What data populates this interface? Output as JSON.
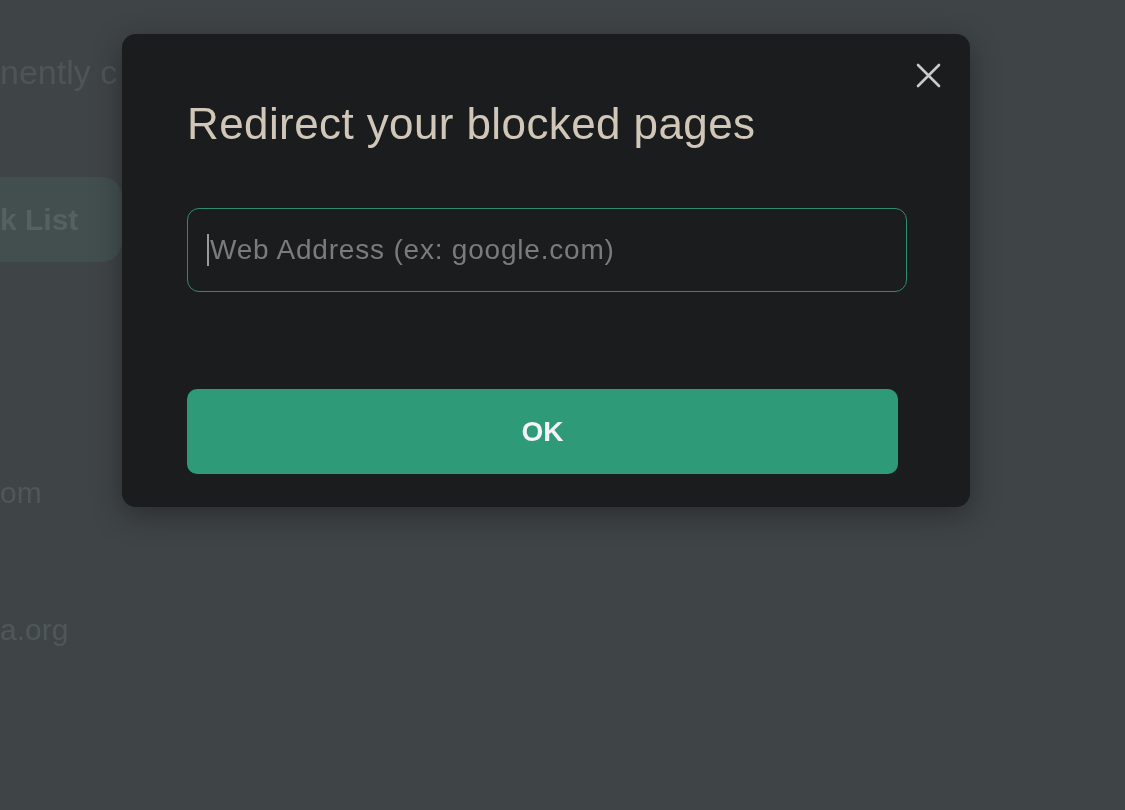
{
  "background_page": {
    "subtitle": "nently c",
    "button": "k List",
    "list_items": [
      "om",
      "a.org"
    ]
  },
  "dialog": {
    "title": "Redirect your blocked pages",
    "field": {
      "placeholder": "Web Address (ex: google.com)",
      "focused": true
    },
    "button": "OK"
  }
}
